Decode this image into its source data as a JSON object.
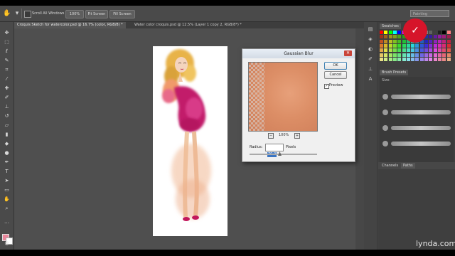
{
  "options_bar": {
    "scroll_all_label": "Scroll All Windows",
    "zoom_100_label": "100%",
    "fit_screen_label": "Fit Screen",
    "fill_screen_label": "Fill Screen",
    "workspace_label": "Painting"
  },
  "doc_tabs": [
    {
      "label": "Croquis Sketch for watercolor.psd @ 16.7% (color, RGB/8) *"
    },
    {
      "label": "Water color croquis.psd @ 12.5% (Layer 1 copy 2, RGB/8*) *"
    }
  ],
  "gaussian_dialog": {
    "title": "Gaussian Blur",
    "ok_label": "OK",
    "cancel_label": "Cancel",
    "preview_label": "Preview",
    "preview_checked": true,
    "zoom_label": "100%",
    "radius_label": "Radius:",
    "radius_value": "70.0",
    "radius_unit": "Pixels"
  },
  "panels": {
    "swatches_tab": "Swatches",
    "brush_presets_tab": "Brush Presets",
    "size_label": "Size:",
    "channels_tab": "Channels",
    "paths_tab": "Paths"
  },
  "branding": {
    "watermark": "lynda.com"
  },
  "colors": {
    "accent_logo": "#d6142a",
    "foreground_swatch": "#e8859a",
    "background_swatch": "#ffffff"
  }
}
